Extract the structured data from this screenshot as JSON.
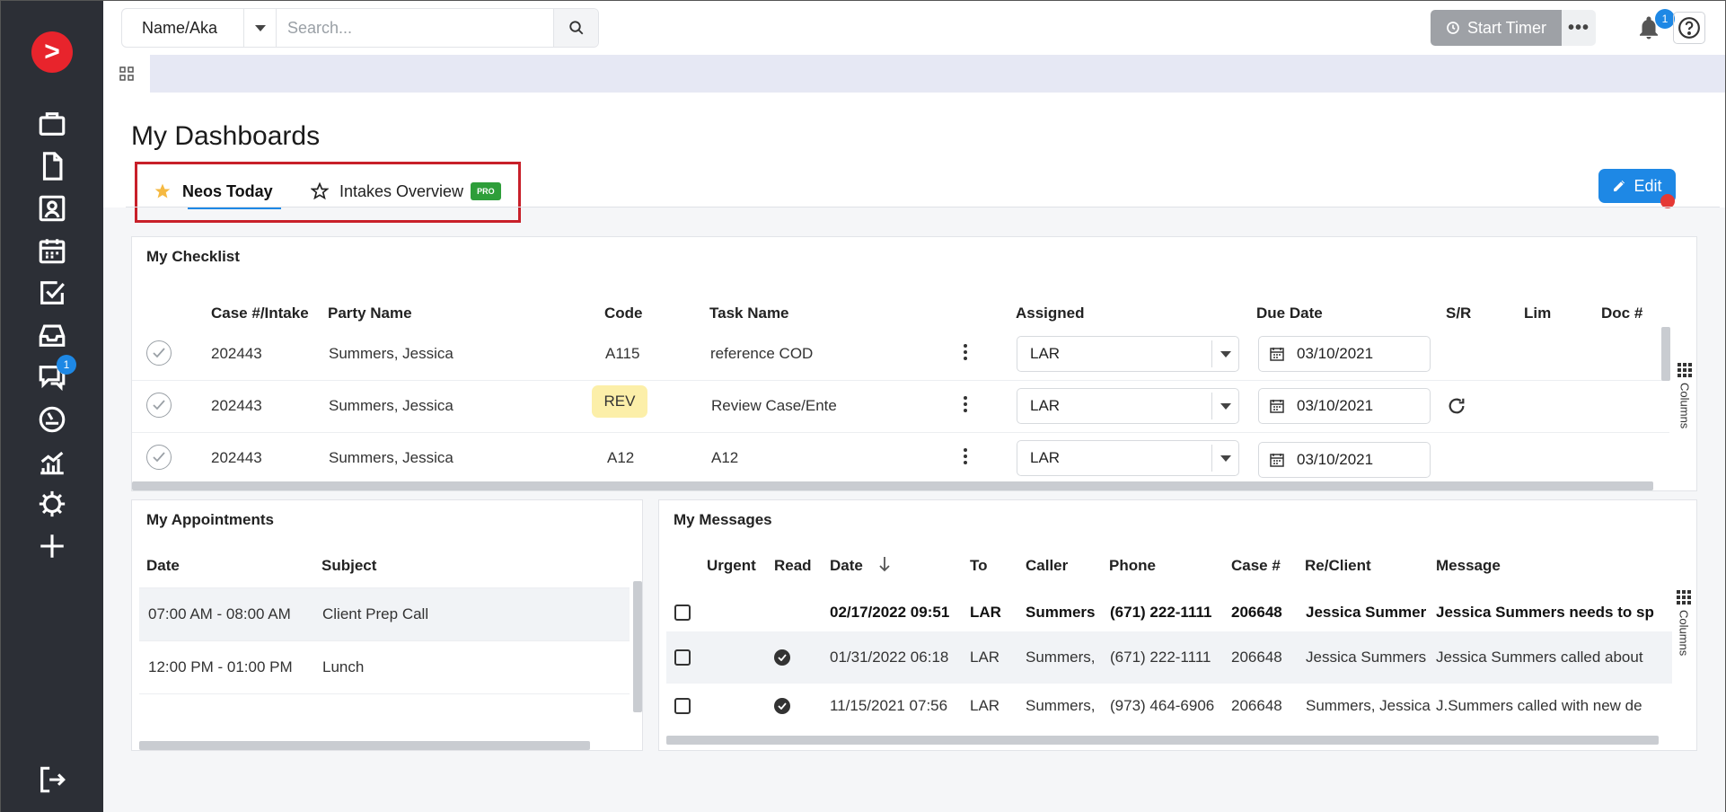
{
  "topbar": {
    "search_type": "Name/Aka",
    "search_placeholder": "Search...",
    "start_timer": "Start Timer",
    "notif_count": "1"
  },
  "sidebar": {
    "messages_badge": "1",
    "icons": [
      "briefcase-icon",
      "document-icon",
      "contact-icon",
      "calendar-icon",
      "checkbox-icon",
      "inbox-icon",
      "chat-icon",
      "gauge-icon",
      "chart-icon",
      "gear-icon",
      "plus-icon",
      "logout-icon"
    ]
  },
  "page": {
    "title": "My Dashboards",
    "tabs": [
      {
        "label": "Neos Today"
      },
      {
        "label": "Intakes Overview",
        "badge": "PRO"
      }
    ],
    "edit_label": "Edit"
  },
  "checklist": {
    "title": "My Checklist",
    "columns": [
      "Case #/Intake",
      "Party Name",
      "Code",
      "Task Name",
      "Assigned",
      "Due Date",
      "S/R",
      "Lim",
      "Doc #"
    ],
    "rows": [
      {
        "case": "202443",
        "party": "Summers, Jessica",
        "code": "A115",
        "task": "reference COD",
        "assigned": "LAR",
        "due": "03/10/2021"
      },
      {
        "case": "202443",
        "party": "Summers, Jessica",
        "code": "REV",
        "task": "Review Case/Ente",
        "assigned": "LAR",
        "due": "03/10/2021"
      },
      {
        "case": "202443",
        "party": "Summers, Jessica",
        "code": "A12",
        "task": "A12",
        "assigned": "LAR",
        "due": "03/10/2021"
      }
    ],
    "columns_label": "Columns"
  },
  "appointments": {
    "title": "My Appointments",
    "columns": [
      "Date",
      "Subject"
    ],
    "rows": [
      {
        "date": "07:00 AM - 08:00 AM",
        "subject": "Client Prep Call"
      },
      {
        "date": "12:00 PM - 01:00 PM",
        "subject": "Lunch"
      }
    ]
  },
  "messages": {
    "title": "My Messages",
    "columns": [
      "Urgent",
      "Read",
      "Date",
      "To",
      "Caller",
      "Phone",
      "Case #",
      "Re/Client",
      "Message"
    ],
    "rows": [
      {
        "date": "02/17/2022 09:51",
        "to": "LAR",
        "caller": "Summers",
        "phone": "(671) 222-1111",
        "case": "206648",
        "client": "Jessica Summer",
        "message": "Jessica Summers needs to sp"
      },
      {
        "date": "01/31/2022 06:18 PI",
        "to": "LAR",
        "caller": "Summers,",
        "phone": "(671) 222-1111",
        "case": "206648",
        "client": "Jessica Summers",
        "message": "Jessica Summers called about"
      },
      {
        "date": "11/15/2021 07:56 PM",
        "to": "LAR",
        "caller": "Summers,",
        "phone": "(973) 464-6906",
        "case": "206648",
        "client": "Summers, Jessica",
        "message": "J.Summers called with new de"
      }
    ],
    "columns_label": "Columns"
  }
}
